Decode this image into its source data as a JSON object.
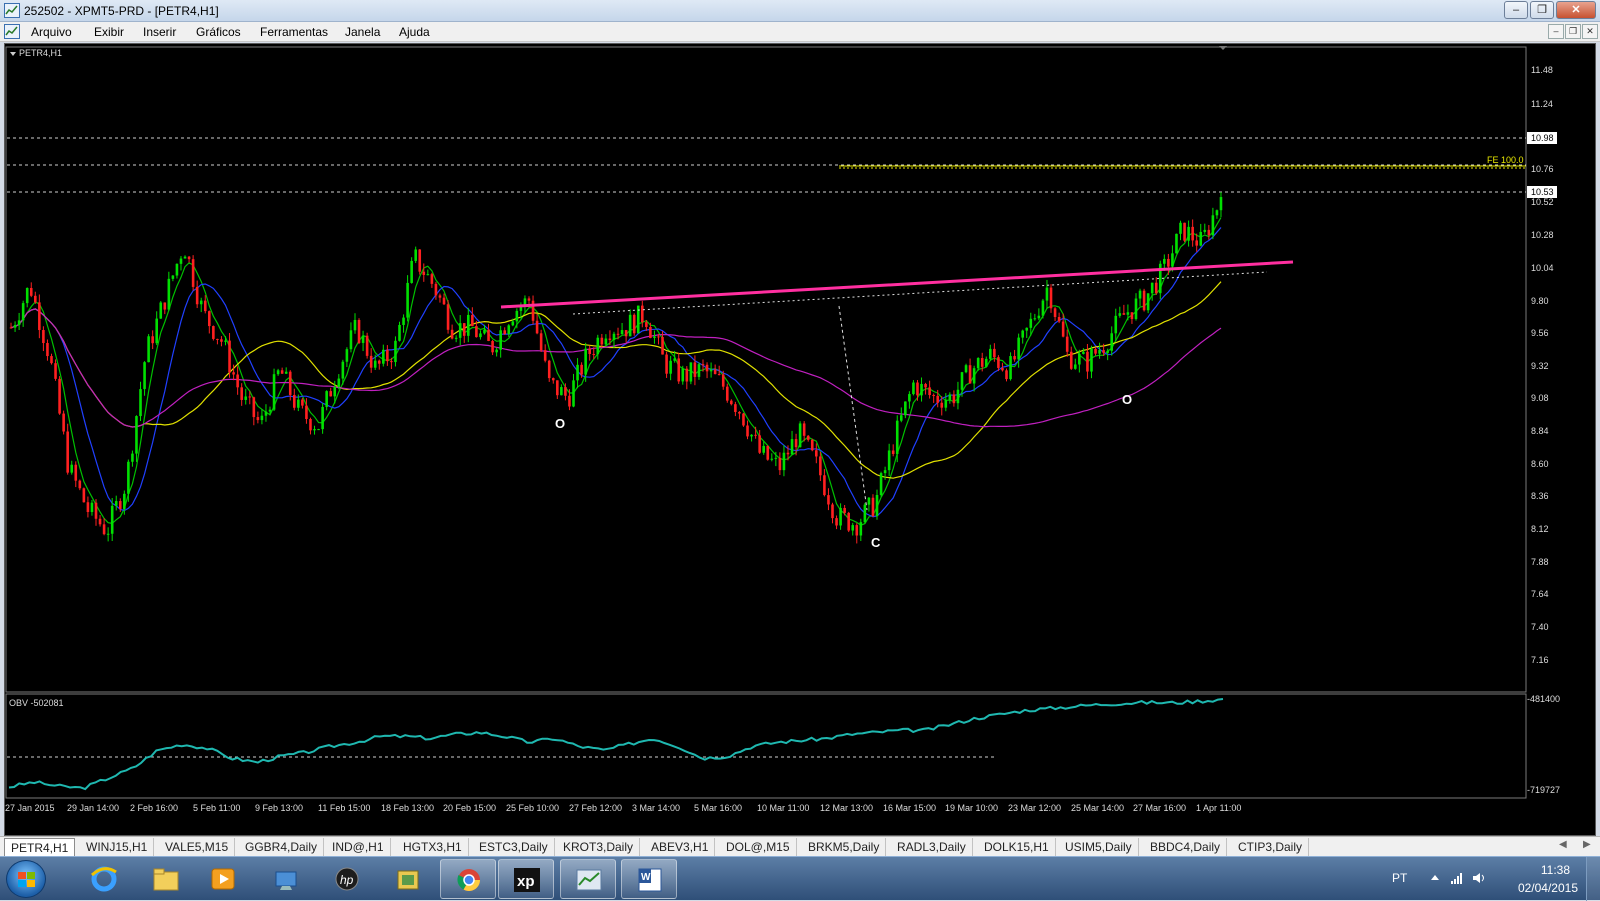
{
  "window": {
    "title": "252502 - XPMT5-PRD - [PETR4,H1]"
  },
  "menu": {
    "items": [
      "Arquivo",
      "Exibir",
      "Inserir",
      "Gráficos",
      "Ferramentas",
      "Janela",
      "Ajuda"
    ]
  },
  "chart": {
    "label": "PETR4,H1",
    "price_axis": [
      "11.48",
      "11.24",
      "10.98",
      "10.76",
      "10.52",
      "10.53",
      "10.28",
      "10.04",
      "9.80",
      "9.56",
      "9.32",
      "9.08",
      "8.84",
      "8.60",
      "8.36",
      "8.12",
      "7.88",
      "7.64",
      "7.40",
      "7.16"
    ],
    "highlight_prices": [
      "10.98",
      "10.53"
    ],
    "fe_label": "FE 100.0",
    "annotations": [
      "O",
      "C",
      "O"
    ],
    "obv_label": "OBV -502081",
    "obv_axis": [
      "-481400",
      "-719727"
    ],
    "time_axis": [
      "27 Jan 2015",
      "29 Jan 14:00",
      "2 Feb 16:00",
      "5 Feb 11:00",
      "9 Feb 13:00",
      "11 Feb 15:00",
      "18 Feb 13:00",
      "20 Feb 15:00",
      "25 Feb 10:00",
      "27 Feb 12:00",
      "3 Mar 14:00",
      "5 Mar 16:00",
      "10 Mar 11:00",
      "12 Mar 13:00",
      "16 Mar 15:00",
      "19 Mar 10:00",
      "23 Mar 12:00",
      "25 Mar 14:00",
      "27 Mar 16:00",
      "1 Apr 11:00"
    ],
    "colors": {
      "bull": "#00e000",
      "bear": "#ff2020",
      "neckline": "#ff2fa0",
      "fe": "#e8e800",
      "obv": "#1fb8b0",
      "ma_fast": "#00c000",
      "ma_mid": "#2040ff",
      "ma_slow": "#e0e000",
      "ma_long": "#c020c0"
    }
  },
  "chart_data": {
    "type": "candlestick",
    "symbol": "PETR4",
    "timeframe": "H1",
    "price_points": [
      9.6,
      9.9,
      9.4,
      8.6,
      8.3,
      8.15,
      8.5,
      9.4,
      9.8,
      10.2,
      9.7,
      9.5,
      9.1,
      8.9,
      9.3,
      9.0,
      8.9,
      9.3,
      9.6,
      9.3,
      9.45,
      10.1,
      9.9,
      9.6,
      9.6,
      9.45,
      9.7,
      9.8,
      9.2,
      9.1,
      9.4,
      9.6,
      9.6,
      9.7,
      9.35,
      9.25,
      9.3,
      9.2,
      9.0,
      8.7,
      8.6,
      8.85,
      8.6,
      8.25,
      8.2,
      8.35,
      8.8,
      9.2,
      9.1,
      9.1,
      9.3,
      9.4,
      9.3,
      9.6,
      9.9,
      9.4,
      9.35,
      9.5,
      9.7,
      9.8,
      10.0,
      10.3,
      10.2,
      10.53
    ],
    "obv_points": [
      -702000,
      -690000,
      -700000,
      -705000,
      -680000,
      -655000,
      -610000,
      -595000,
      -605000,
      -630000,
      -640000,
      -625000,
      -615000,
      -600000,
      -590000,
      -575000,
      -575000,
      -580000,
      -570000,
      -565000,
      -575000,
      -590000,
      -580000,
      -600000,
      -610000,
      -595000,
      -580000,
      -600000,
      -630000,
      -625000,
      -600000,
      -590000,
      -585000,
      -580000,
      -570000,
      -565000,
      -560000,
      -560000,
      -545000,
      -530000,
      -520000,
      -510000,
      -505000,
      -500000,
      -495000,
      -492000,
      -490000,
      -491000,
      -487000,
      -482000
    ],
    "ylim": [
      7.0,
      11.6
    ],
    "obv_ylim": [
      -719727,
      -481400
    ]
  },
  "tabs": [
    "PETR4,H1",
    "WINJ15,H1",
    "VALE5,M15",
    "GGBR4,Daily",
    "IND@,H1",
    "HGTX3,H1",
    "ESTC3,Daily",
    "KROT3,Daily",
    "ABEV3,H1",
    "DOL@,M15",
    "BRKM5,Daily",
    "RADL3,Daily",
    "DOLK15,H1",
    "USIM5,Daily",
    "BBDC4,Daily",
    "CTIP3,Daily"
  ],
  "taskbar": {
    "icons": [
      "start-icon",
      "ie-icon",
      "explorer-icon",
      "media-icon",
      "network-icon",
      "hp-icon",
      "archive-icon",
      "chrome-icon",
      "xp-icon",
      "metatrader-icon",
      "word-icon"
    ],
    "lang": "PT",
    "time": "11:38",
    "date": "02/04/2015"
  }
}
